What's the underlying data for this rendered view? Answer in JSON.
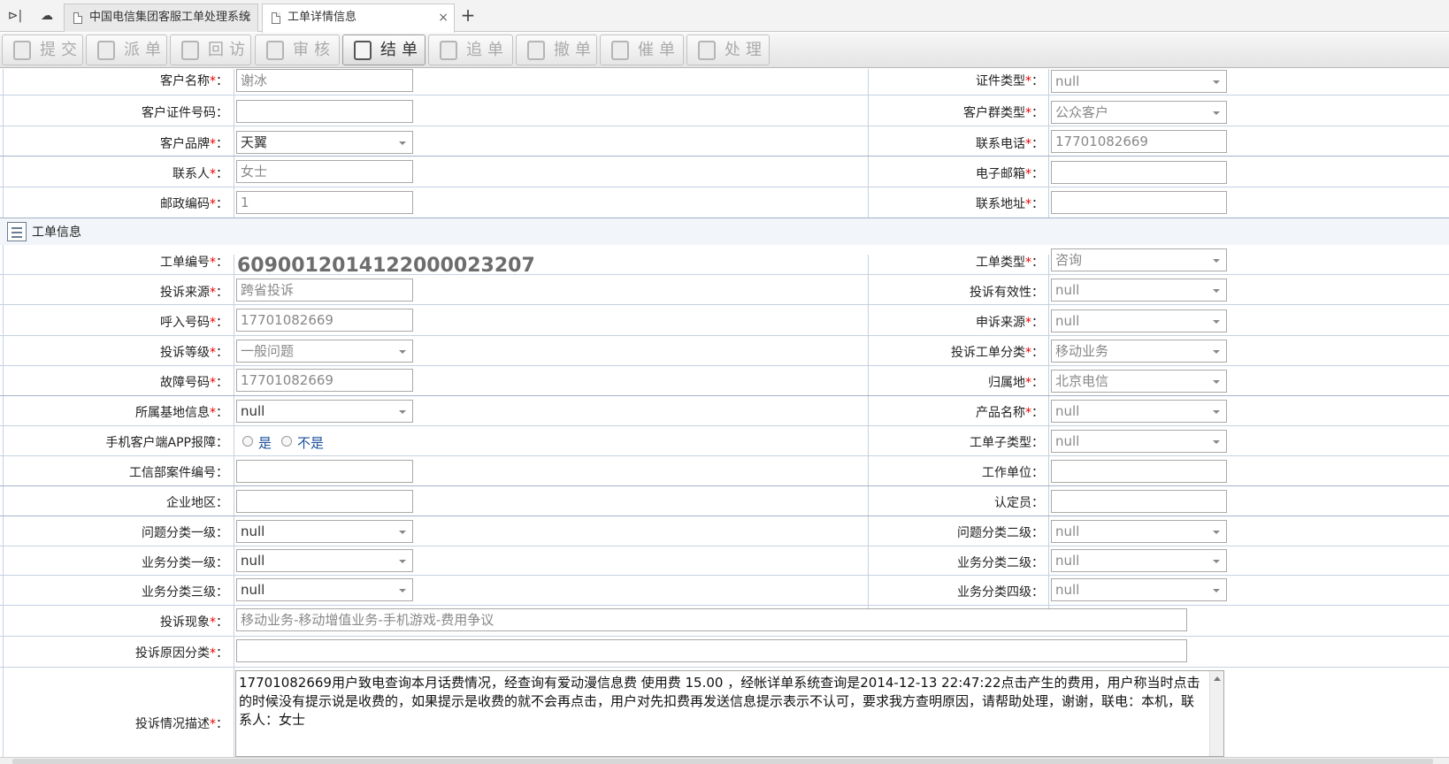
{
  "tabs": [
    {
      "title": "中国电信集团客服工单处理系统"
    },
    {
      "title": "工单详情信息"
    }
  ],
  "toolbar": [
    "提交",
    "派单",
    "回访",
    "审核",
    "结单",
    "追单",
    "撤单",
    "催单",
    "处理"
  ],
  "customer": {
    "name_label": "客户名称",
    "name_value": "谢冰",
    "idtype_label": "证件类型",
    "idtype_value": "null",
    "idno_label": "客户证件号码",
    "idno_value": "",
    "group_label": "客户群类型",
    "group_value": "公众客户",
    "brand_label": "客户品牌",
    "brand_value": "天翼",
    "phone_label": "联系电话",
    "phone_value": "17701082669",
    "contact_label": "联系人",
    "contact_value": "女士",
    "email_label": "电子邮箱",
    "email_value": "",
    "postcode_label": "邮政编码",
    "postcode_value": "1",
    "address_label": "联系地址",
    "address_value": ""
  },
  "section_title": "工单信息",
  "order": {
    "no_label": "工单编号",
    "no_value": "609001201412200002320 7",
    "type_label": "工单类型",
    "type_value": "咨询",
    "source_label": "投诉来源",
    "source_value": "跨省投诉",
    "valid_label": "投诉有效性",
    "valid_value": "null",
    "callin_label": "呼入号码",
    "callin_value": "17701082669",
    "appeal_label": "申诉来源",
    "appeal_value": "null",
    "level_label": "投诉等级",
    "level_value": "一般问题",
    "category_label": "投诉工单分类",
    "category_value": "移动业务",
    "fault_label": "故障号码",
    "fault_value": "17701082669",
    "region_label": "归属地",
    "region_value": "北京电信",
    "base_label": "所属基地信息",
    "base_value": "null",
    "product_label": "产品名称",
    "product_value": "null",
    "app_label": "手机客户端APP报障",
    "app_yes": "是",
    "app_no": "不是",
    "subtype_label": "工单子类型",
    "subtype_value": "null",
    "miit_label": "工信部案件编号",
    "miit_value": "",
    "unit_label": "工作单位",
    "unit_value": "",
    "area_label": "企业地区",
    "area_value": "",
    "judge_label": "认定员",
    "judge_value": "",
    "q1_label": "问题分类一级",
    "q1_value": "null",
    "q2_label": "问题分类二级",
    "q2_value": "null",
    "b1_label": "业务分类一级",
    "b1_value": "null",
    "b2_label": "业务分类二级",
    "b2_value": "null",
    "b3_label": "业务分类三级",
    "b3_value": "null",
    "b4_label": "业务分类四级",
    "b4_value": "null",
    "phenomenon_label": "投诉现象",
    "phenomenon_value": "移动业务-移动增值业务-手机游戏-费用争议",
    "reason_label": "投诉原因分类",
    "reason_value": "",
    "desc_label": "投诉情况描述",
    "desc_value": "17701082669用户致电查询本月话费情况，经查询有爱动漫信息费 使用费 15.00 ，经帐详单系统查询是2014-12-13 22:47:22点击产生的费用，用户称当时点击的时候没有提示说是收费的，如果提示是收费的就不会再点击，用户对先扣费再发送信息提示表示不认可，要求我方查明原因，请帮助处理，谢谢，联电：本机，联系人：女士"
  }
}
